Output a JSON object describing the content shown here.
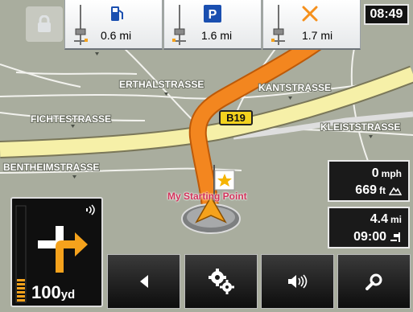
{
  "map": {
    "streets": [
      "ERTHALSTRASSE",
      "KANTSTRASSE",
      "FICHTESTRASSE",
      "KLEISTSTRASSE",
      "BENTHEIMSTRASSE"
    ],
    "road_shield": "B19",
    "current_position_label": "My Starting Point"
  },
  "poi_bar": {
    "items": [
      {
        "icon": "fuel-station-icon",
        "distance": "0.6 mi"
      },
      {
        "icon": "parking-icon",
        "distance": "1.6 mi"
      },
      {
        "icon": "restaurant-icon",
        "distance": "1.7 mi"
      }
    ]
  },
  "clock": "08:49",
  "speed_panel": {
    "speed": "0",
    "speed_unit": "mph",
    "elevation": "669",
    "elevation_unit": "ft"
  },
  "route_panel": {
    "remaining": "4.4",
    "remaining_unit": "mi",
    "eta": "09:00"
  },
  "turn_panel": {
    "distance": "100",
    "distance_unit": "yd"
  },
  "toolbar": {
    "buttons": [
      "back-icon",
      "settings-icon",
      "volume-icon",
      "search-icon"
    ]
  },
  "colors": {
    "route": "#f3861f",
    "highway": "#f6f0a8",
    "map_background": "#a7ab9c",
    "panel": "#131313",
    "turn_arrow": "#f5a21c"
  }
}
